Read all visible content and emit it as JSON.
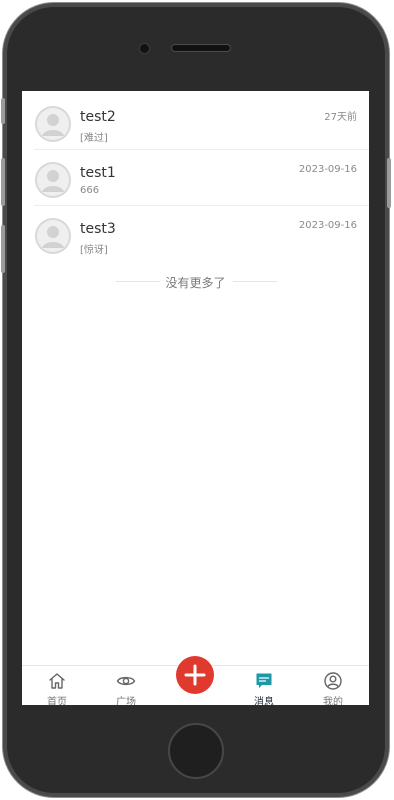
{
  "messages": [
    {
      "name": "test2",
      "snippet": "[难过]",
      "time": "27天前"
    },
    {
      "name": "test1",
      "snippet": "666",
      "time": "2023-09-16"
    },
    {
      "name": "test3",
      "snippet": "[惊讶]",
      "time": "2023-09-16"
    }
  ],
  "list": {
    "no_more": "没有更多了"
  },
  "tabbar": {
    "home": "首页",
    "square": "广场",
    "messages": "消息",
    "mine": "我的"
  },
  "colors": {
    "accent": "#1a9aa6",
    "publish": "#e03a2f"
  },
  "icons": {
    "home": "home-icon",
    "square": "eye-icon",
    "publish": "plus-icon",
    "messages": "chat-bubble-icon",
    "mine": "user-circle-icon"
  }
}
